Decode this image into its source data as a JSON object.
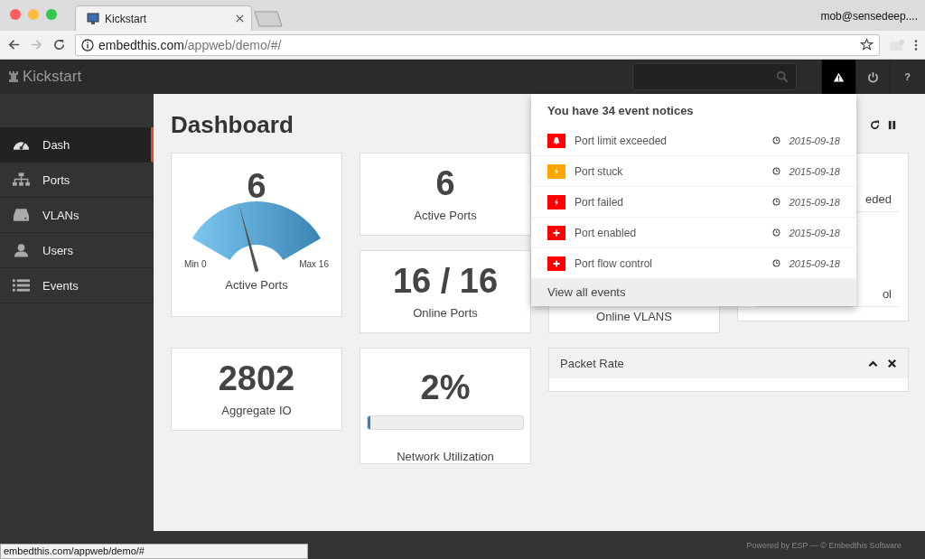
{
  "browser": {
    "tab": {
      "title": "Kickstart"
    },
    "profile": "mob@sensedeep....",
    "address": {
      "host": "embedthis.com",
      "path": "/appweb/demo/#/"
    },
    "status_url": "embedthis.com/appweb/demo/#"
  },
  "app": {
    "brand": "Kickstart",
    "header_buttons": [
      {
        "kind": "alert",
        "selected": true
      },
      {
        "kind": "power",
        "selected": false
      },
      {
        "kind": "help",
        "label": "?",
        "selected": false
      }
    ]
  },
  "sidebar": {
    "items": [
      {
        "label": "Dash",
        "kind": "dashboard",
        "selected": true
      },
      {
        "label": "Ports",
        "kind": "sitemap",
        "selected": false
      },
      {
        "label": "VLANs",
        "kind": "drive",
        "selected": false
      },
      {
        "label": "Users",
        "kind": "user",
        "selected": false
      },
      {
        "label": "Events",
        "kind": "list",
        "selected": false
      }
    ]
  },
  "page": {
    "title": "Dashboard"
  },
  "gauge": {
    "value": "6",
    "label": "Active Ports",
    "min": "Min 0",
    "max": "Max 16",
    "level": 0.375
  },
  "stats": [
    {
      "value": "6",
      "label": "Active Ports"
    },
    {
      "value": "16 / 16",
      "label": "Online Ports"
    },
    {
      "value": "2802",
      "label": "Aggregate IO"
    }
  ],
  "utilization": {
    "value": "2%",
    "label": "Network Utilization",
    "level": 0.02
  },
  "vlans_card": {
    "label": "Online VLANS"
  },
  "side_card": {
    "lines": [
      "eded",
      "ol"
    ]
  },
  "packet_panel": {
    "title": "Packet Rate"
  },
  "notices": {
    "title": "You have 34 event notices",
    "items": [
      {
        "kind": "bell",
        "color": "#ff0000",
        "text": "Port limit exceeded",
        "date": "2015-09-18"
      },
      {
        "kind": "bolt",
        "color": "#ffa500",
        "text": "Port stuck",
        "date": "2015-09-18"
      },
      {
        "kind": "bolt",
        "color": "#ff0000",
        "text": "Port failed",
        "date": "2015-09-18"
      },
      {
        "kind": "plus",
        "color": "#ff0000",
        "text": "Port enabled",
        "date": "2015-09-18"
      },
      {
        "kind": "plus",
        "color": "#ff0000",
        "text": "Port flow control",
        "date": "2015-09-18"
      }
    ],
    "footer_link": "View all events"
  },
  "footer": {
    "text": "Powered by ESP — © Embedthis Software"
  }
}
